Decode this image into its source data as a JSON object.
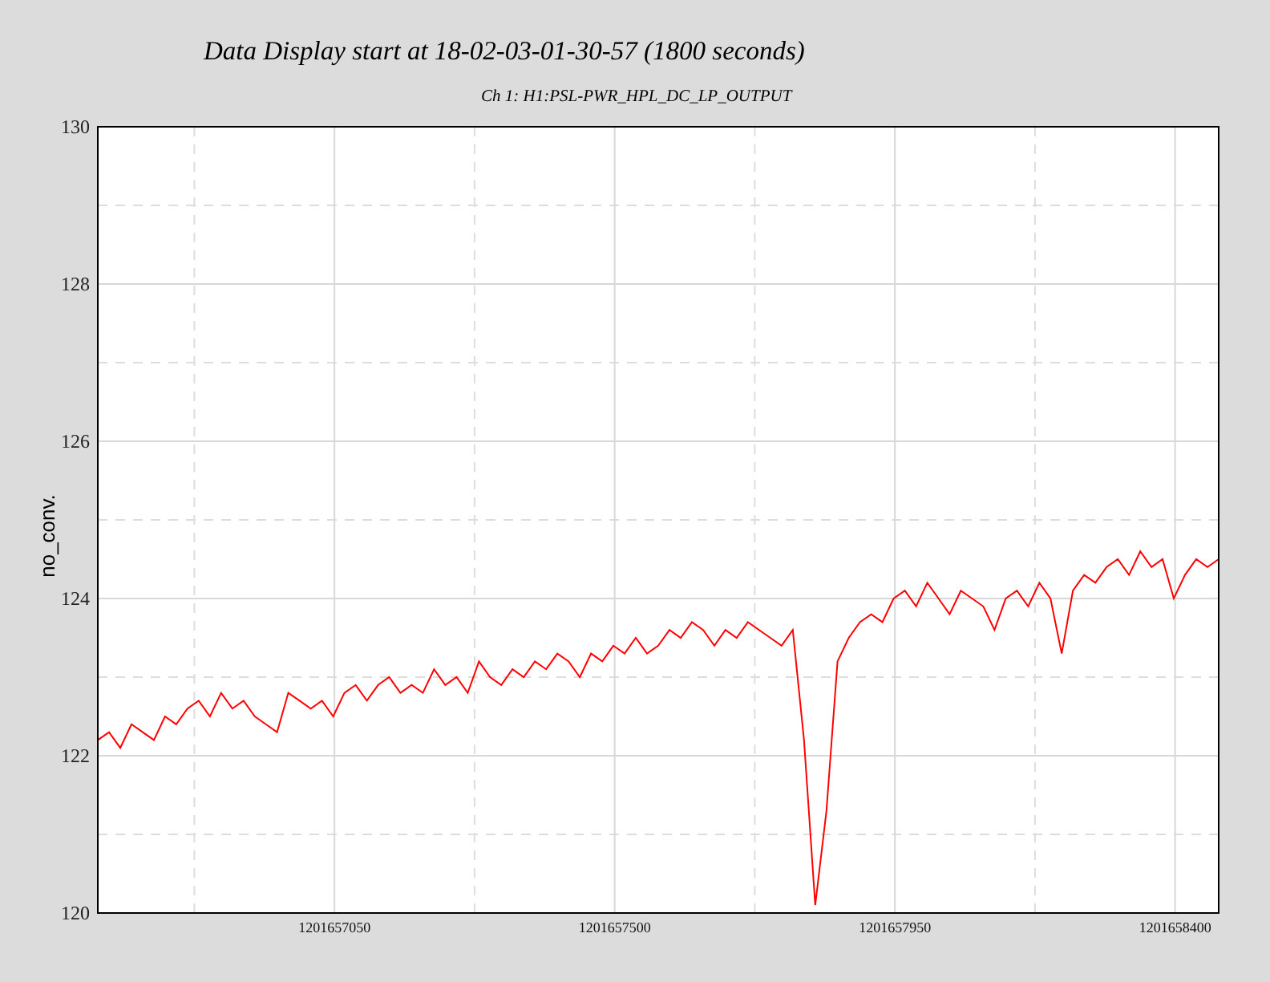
{
  "window": {
    "title": "Data Display start at 18-02-03-01-30-57 (1800 seconds)"
  },
  "plot": {
    "chart_data": {
      "type": "line",
      "title": "Ch 1: H1:PSL-PWR_HPL_DC_LP_OUTPUT",
      "ylabel": "no_conv.",
      "xlim": [
        1201656670,
        1201658470
      ],
      "ylim": [
        120,
        130
      ],
      "xticks": [
        {
          "value": 1201657050,
          "label": "1201657050"
        },
        {
          "value": 1201657500,
          "label": "1201657500"
        },
        {
          "value": 1201657950,
          "label": "1201657950"
        },
        {
          "value": 1201658400,
          "label": "1201658400"
        }
      ],
      "yticks": [
        120,
        122,
        124,
        126,
        128,
        130
      ],
      "grid": true,
      "x": [
        1201656670,
        1201656688,
        1201656706,
        1201656724,
        1201656742,
        1201656760,
        1201656778,
        1201656796,
        1201656814,
        1201656832,
        1201656850,
        1201656868,
        1201656886,
        1201656904,
        1201656922,
        1201656940,
        1201656958,
        1201656976,
        1201656994,
        1201657012,
        1201657030,
        1201657048,
        1201657066,
        1201657084,
        1201657102,
        1201657120,
        1201657138,
        1201657156,
        1201657174,
        1201657192,
        1201657210,
        1201657228,
        1201657246,
        1201657264,
        1201657282,
        1201657300,
        1201657318,
        1201657336,
        1201657354,
        1201657372,
        1201657390,
        1201657408,
        1201657426,
        1201657444,
        1201657462,
        1201657480,
        1201657498,
        1201657516,
        1201657534,
        1201657552,
        1201657570,
        1201657588,
        1201657606,
        1201657624,
        1201657642,
        1201657660,
        1201657678,
        1201657696,
        1201657714,
        1201657732,
        1201657750,
        1201657768,
        1201657786,
        1201657804,
        1201657822,
        1201657840,
        1201657858,
        1201657876,
        1201657894,
        1201657912,
        1201657930,
        1201657948,
        1201657966,
        1201657984,
        1201658002,
        1201658020,
        1201658038,
        1201658056,
        1201658074,
        1201658092,
        1201658110,
        1201658128,
        1201658146,
        1201658164,
        1201658182,
        1201658200,
        1201658218,
        1201658236,
        1201658254,
        1201658272,
        1201658290,
        1201658308,
        1201658326,
        1201658344,
        1201658362,
        1201658380,
        1201658398,
        1201658416,
        1201658434,
        1201658452,
        1201658470
      ],
      "series": [
        {
          "color": "#ff0000",
          "values": [
            122.2,
            122.3,
            122.1,
            122.4,
            122.3,
            122.2,
            122.5,
            122.4,
            122.6,
            122.7,
            122.5,
            122.8,
            122.6,
            122.7,
            122.5,
            122.4,
            122.3,
            122.8,
            122.7,
            122.6,
            122.7,
            122.5,
            122.8,
            122.9,
            122.7,
            122.9,
            123.0,
            122.8,
            122.9,
            122.8,
            123.1,
            122.9,
            123.0,
            122.8,
            123.2,
            123.0,
            122.9,
            123.1,
            123.0,
            123.2,
            123.1,
            123.3,
            123.2,
            123.0,
            123.3,
            123.2,
            123.4,
            123.3,
            123.5,
            123.3,
            123.4,
            123.6,
            123.5,
            123.7,
            123.6,
            123.4,
            123.6,
            123.5,
            123.7,
            123.6,
            123.5,
            123.4,
            123.6,
            122.2,
            120.1,
            121.3,
            123.2,
            123.5,
            123.7,
            123.8,
            123.7,
            124.0,
            124.1,
            123.9,
            124.2,
            124.0,
            123.8,
            124.1,
            124.0,
            123.9,
            123.6,
            124.0,
            124.1,
            123.9,
            124.2,
            124.0,
            123.3,
            124.1,
            124.3,
            124.2,
            124.4,
            124.5,
            124.3,
            124.6,
            124.4,
            124.5,
            124.0,
            124.3,
            124.5,
            124.4,
            124.5
          ]
        }
      ]
    }
  }
}
